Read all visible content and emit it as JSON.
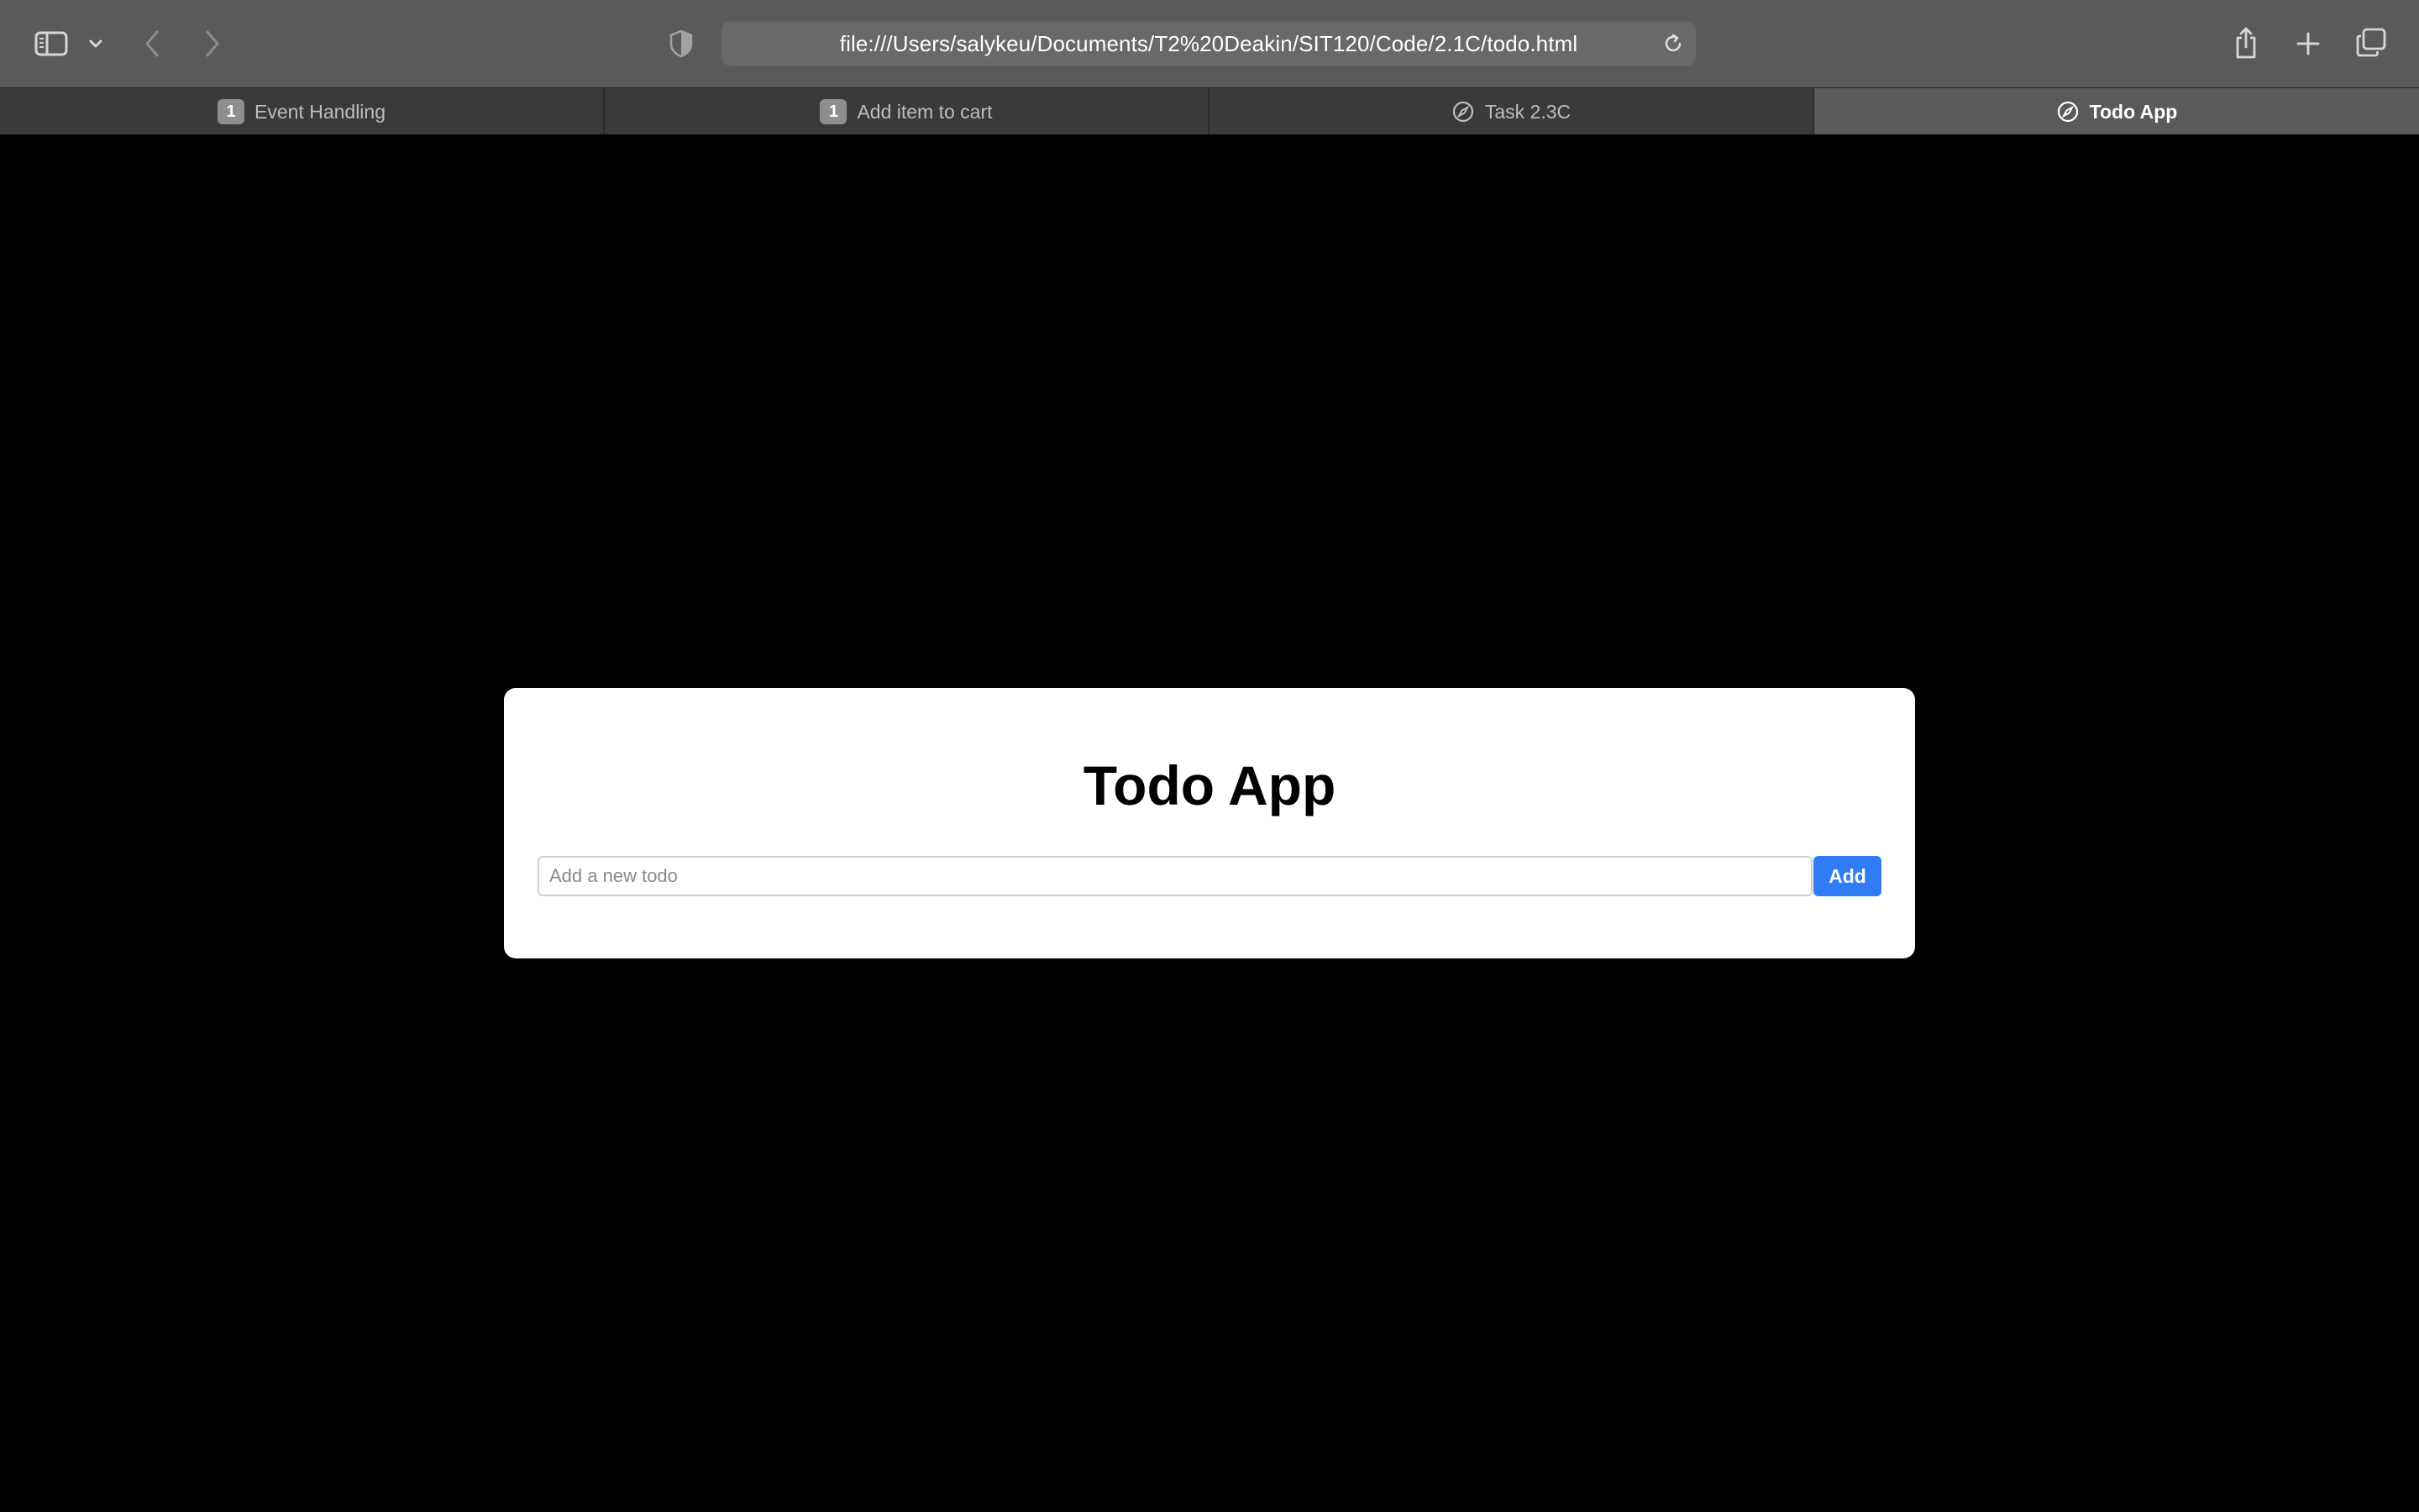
{
  "browser": {
    "url": "file:///Users/salykeu/Documents/T2%20Deakin/SIT120/Code/2.1C/todo.html",
    "icons": {
      "sidebar": "sidebar-icon",
      "sidebar_menu": "chevron-down-icon",
      "back": "chevron-left-icon",
      "forward": "chevron-right-icon",
      "privacy": "shield-icon",
      "reload": "reload-icon",
      "share": "share-icon",
      "new_tab": "plus-icon",
      "tab_overview": "tab-overview-icon"
    }
  },
  "tabs": [
    {
      "label": "Event Handling",
      "badge": "1",
      "active": false
    },
    {
      "label": "Add item to cart",
      "badge": "1",
      "active": false
    },
    {
      "label": "Task 2.3C",
      "icon": "compass-icon",
      "active": false
    },
    {
      "label": "Todo App",
      "icon": "compass-icon",
      "active": true
    }
  ],
  "app": {
    "title": "Todo App",
    "input_placeholder": "Add a new todo",
    "input_value": "",
    "add_label": "Add",
    "accent_color": "#2f7cf6"
  }
}
